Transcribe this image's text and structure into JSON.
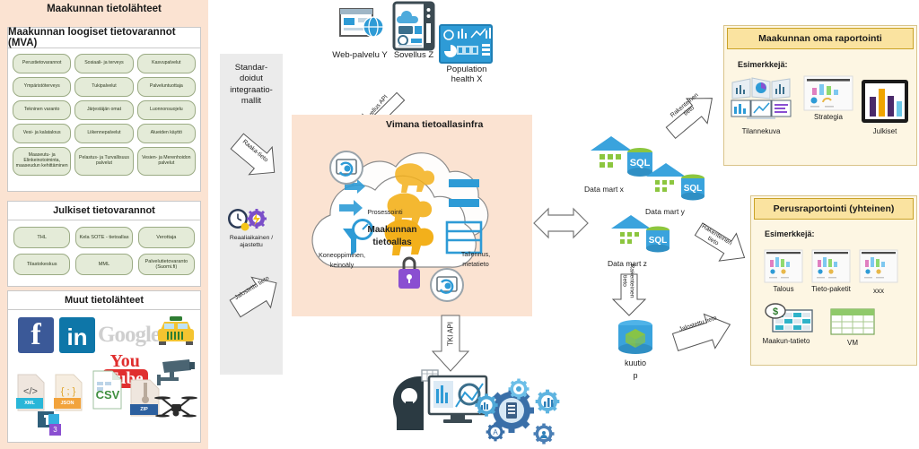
{
  "left_panel": {
    "title": "Maakunnan tietolähteet",
    "sections": [
      {
        "title": "Maakunnan loogiset tietovarannot (MVA)",
        "items": [
          "Perustietovarannot",
          "Sosiaali- ja terveys",
          "Kasvupalvelut",
          "Ympäristöterveys",
          "Tukipalvelut",
          "Palveluntuottaja",
          "Tekninen varanto",
          "Järjestäjän omat",
          "Luonnonsuojelu",
          "Vesi- ja kalatalous",
          "Liikennepalvelut",
          "Alueiden käyttö",
          "Maaseutu- ja Elinkeinotoiminta, maaseudun kehittäminen",
          "Pelastus- ja Turvallisuus palvelut",
          "Vesien- ja Merenhoidon palvelut"
        ]
      },
      {
        "title": "Julkiset tietovarannot",
        "items": [
          "THL",
          "Kela SOTE - tietoallas",
          "Verottaja",
          "Tilastokeskus",
          "MML",
          "Palvelutietovaranto (Suomi.fi)"
        ]
      },
      {
        "title": "Muut tietolähteet",
        "icons": [
          "facebook-icon",
          "linkedin-icon",
          "google-icon",
          "taxi-icon",
          "youtube-icon",
          "xml-file-icon",
          "json-file-icon",
          "csv-file-icon",
          "zip-file-icon",
          "security-camera-icon",
          "drone-icon",
          "teams-app-icon"
        ],
        "icon_labels": {
          "facebook": "f",
          "linkedin": "in",
          "google": "Google",
          "youtube_top": "You",
          "youtube_bottom": "Tube",
          "xml": "XML",
          "json": "JSON",
          "csv": "CSV",
          "zip": "ZIP",
          "teams": "3"
        }
      }
    ]
  },
  "standards_column": {
    "title": "Standar-\ndoidut\nintegraatio-\nmallit",
    "title_lines": [
      "Standar-",
      "doidut",
      "integraatio-",
      "mallit"
    ],
    "arrow_raw": "Raaka-tieto",
    "schedule_label": "Reaaliaikainen / ajastettu",
    "schedule_icons": [
      "clock-icon",
      "gear-bolt-icon"
    ],
    "arrow_refined": "Jalostettu tieto"
  },
  "top_apps": [
    {
      "label": "Web-palvelu Y",
      "icon": "web-service-icon"
    },
    {
      "label": "Sovellus Z",
      "icon": "application-server-icon"
    },
    {
      "label": "Population health X",
      "icon": "dashboard-screen-icon"
    }
  ],
  "arrows": {
    "sovellus_api": "Sovellus API",
    "tki_api": "TKI API",
    "rakenteinen_tieto": "Rakenteinen tieto",
    "jalostettu_tieto": "Jalostettu tieto",
    "raaka_tieto": "Raaka-tieto",
    "bidirectional": "bidirectional-arrow-icon"
  },
  "center": {
    "title": "Vimana tietoallasinfra",
    "lake_title_line1": "Maakunnan",
    "lake_title_line2": "tietoallas",
    "processing": "Prosessointi",
    "ml_line1": "Koneoppiminen,",
    "ml_line2": "keinoäly",
    "storage_line1": "Tallennus,",
    "storage_line2": "metatieto",
    "icons": [
      "hadoop-elephant-icon",
      "lock-icon",
      "ml-funnel-icon",
      "database-table-icon",
      "stream-icon"
    ]
  },
  "data_marts": [
    {
      "label": "Data mart x",
      "icon": "sql-warehouse-icon"
    },
    {
      "label": "Data mart y",
      "icon": "sql-warehouse-icon"
    },
    {
      "label": "Data mart z",
      "icon": "sql-warehouse-icon"
    }
  ],
  "cube": {
    "label_line1": "kuutio",
    "label_line2": "p",
    "icon": "cube-database-icon"
  },
  "analytics": {
    "icons": [
      "head-lightbulb-icon",
      "analytics-monitor-icon",
      "gear-cluster-icon"
    ]
  },
  "reporting_own": {
    "title": "Maakunnan oma raportointi",
    "examples_label": "Esimerkkejä:",
    "items": [
      {
        "label": "Tilannekuva",
        "icon": "dashboards-icon"
      },
      {
        "label": "Strategia",
        "icon": "strategy-report-icon"
      },
      {
        "label": "Julkiset",
        "icon": "public-barchart-icon"
      }
    ]
  },
  "reporting_basic": {
    "title": "Perusraportointi (yhteinen)",
    "examples_label": "Esimerkkejä:",
    "items": [
      {
        "label": "Talous",
        "icon": "report-icon"
      },
      {
        "label": "Tieto-paketit",
        "icon": "report-icon"
      },
      {
        "label": "xxx",
        "icon": "report-icon"
      },
      {
        "label": "Maakun-tatieto",
        "icon": "money-table-icon"
      },
      {
        "label": "VM",
        "icon": "green-table-icon"
      }
    ]
  },
  "colors": {
    "panel_peach": "#fbe3d2",
    "pill_green": "#e4ebd8",
    "box_cream": "#fdf6e3",
    "box_header_yellow": "#fae3a0",
    "std_gray": "#ebebeb",
    "accent_blue": "#2e9bd6"
  }
}
